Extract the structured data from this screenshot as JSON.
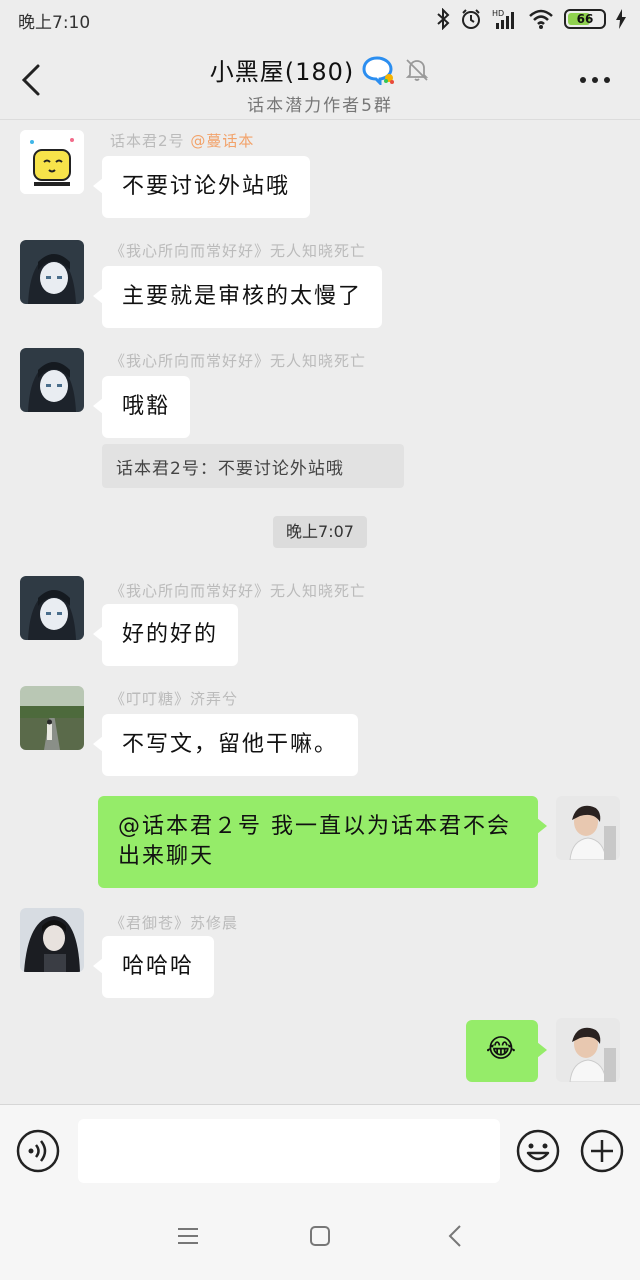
{
  "status_bar": {
    "time": "晚上7:10",
    "battery": "66",
    "battery_level": 0.66
  },
  "header": {
    "title": "小黑屋(180)",
    "subtitle": "话本潜力作者5群"
  },
  "messages": [
    {
      "sender": "话本君2号",
      "mention": "@蔓话本",
      "text": "不要讨论外站哦",
      "avatar": "cartoon-face-avatar"
    },
    {
      "sender": "《我心所向而常好好》无人知晓死亡",
      "text": "主要就是审核的太慢了",
      "avatar": "anime-girl-avatar"
    },
    {
      "sender": "《我心所向而常好好》无人知晓死亡",
      "text": "哦豁",
      "avatar": "anime-girl-avatar"
    },
    {
      "sender": "《我心所向而常好好》无人知晓死亡",
      "text": "好的好的",
      "avatar": "anime-girl-avatar"
    },
    {
      "sender": "《叮叮糖》济弄兮",
      "text": "不写文，留他干嘛。",
      "avatar": "road-photo-avatar"
    },
    {
      "text": "@话本君２号  我一直以为话本君不会出来聊天",
      "avatar": "boy-photo-avatar"
    },
    {
      "sender": "《君御苍》苏修晨",
      "text": "哈哈哈",
      "avatar": "dark-hair-anime-avatar"
    },
    {
      "emoji": "😂",
      "avatar": "boy-photo-avatar"
    }
  ],
  "quote": "话本君2号：不要讨论外站哦",
  "timestamp": "晚上7:07",
  "input": {
    "placeholder": ""
  },
  "colors": {
    "background": "#ededed",
    "my_bubble": "#95ec69",
    "other_bubble": "#ffffff",
    "mention": "#f2a36b"
  }
}
